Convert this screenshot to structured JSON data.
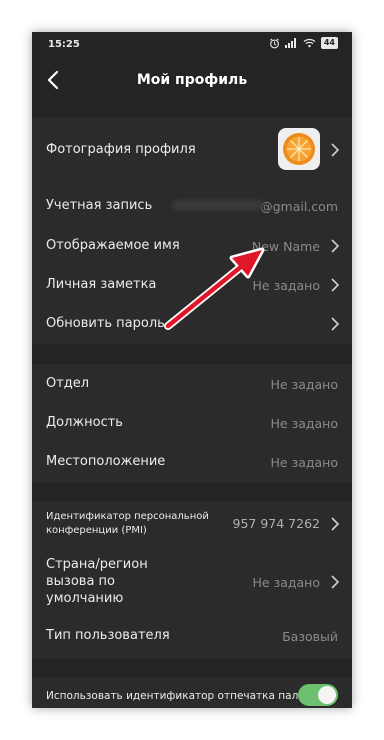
{
  "status_bar": {
    "time": "15:25",
    "battery": "44"
  },
  "header": {
    "title": "Мой профиль"
  },
  "profile": {
    "photo_label": "Фотография профиля",
    "account_label": "Учетная запись",
    "account_value": "@gmail.com",
    "display_name_label": "Отображаемое имя",
    "display_name_value": "New Name",
    "note_label": "Личная заметка",
    "note_value": "Не задано",
    "password_label": "Обновить пароль"
  },
  "work": {
    "department_label": "Отдел",
    "department_value": "Не задано",
    "position_label": "Должность",
    "position_value": "Не задано",
    "location_label": "Местоположение",
    "location_value": "Не задано"
  },
  "meeting": {
    "pmi_label_line1": "Идентификатор персональной",
    "pmi_label_line2": "конференции (PMI)",
    "pmi_value": "957 974 7262",
    "region_label_line1": "Страна/регион",
    "region_label_line2": "вызова по",
    "region_label_line3": "умолчанию",
    "region_value": "Не задано",
    "user_type_label": "Тип пользователя",
    "user_type_value": "Базовый"
  },
  "fingerprint": {
    "label": "Использовать идентификатор отпечатка пальца",
    "enabled": true
  },
  "colors": {
    "background": "#242424",
    "section": "#2b2b2b",
    "accent_toggle": "#6cc070",
    "annotation_arrow": "#e0162b"
  }
}
